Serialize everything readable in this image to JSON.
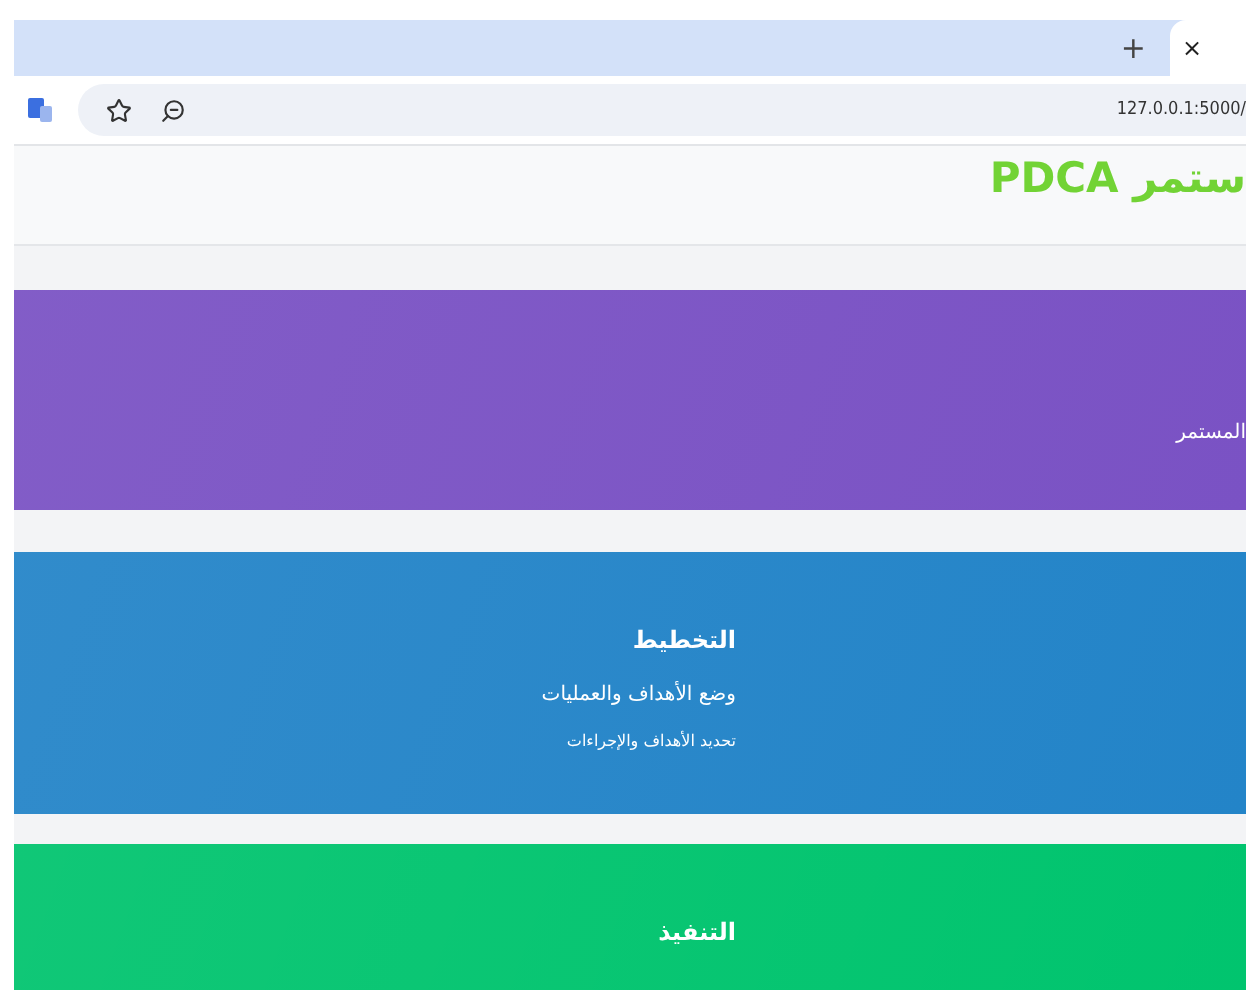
{
  "browser": {
    "new_tab": "+",
    "close_tab": "×",
    "url": "127.0.0.1:5000/"
  },
  "page": {
    "title": "ستمر PDCA"
  },
  "cards": [
    {
      "kind": "banner",
      "color": "#7a52c4",
      "texts": [
        {
          "kind": "subtitle",
          "text": "المستمر"
        }
      ]
    },
    {
      "kind": "phase",
      "color": "#2384c8",
      "texts": [
        {
          "kind": "heading",
          "text": "التخطيط"
        },
        {
          "kind": "subtitle",
          "text": "وضع الأهداف والعمليات"
        },
        {
          "kind": "detail",
          "text": "تحديد الأهداف والإجراءات"
        }
      ]
    },
    {
      "kind": "phase",
      "color": "#00c46e",
      "texts": [
        {
          "kind": "heading",
          "text": "التنفيذ"
        }
      ]
    }
  ]
}
